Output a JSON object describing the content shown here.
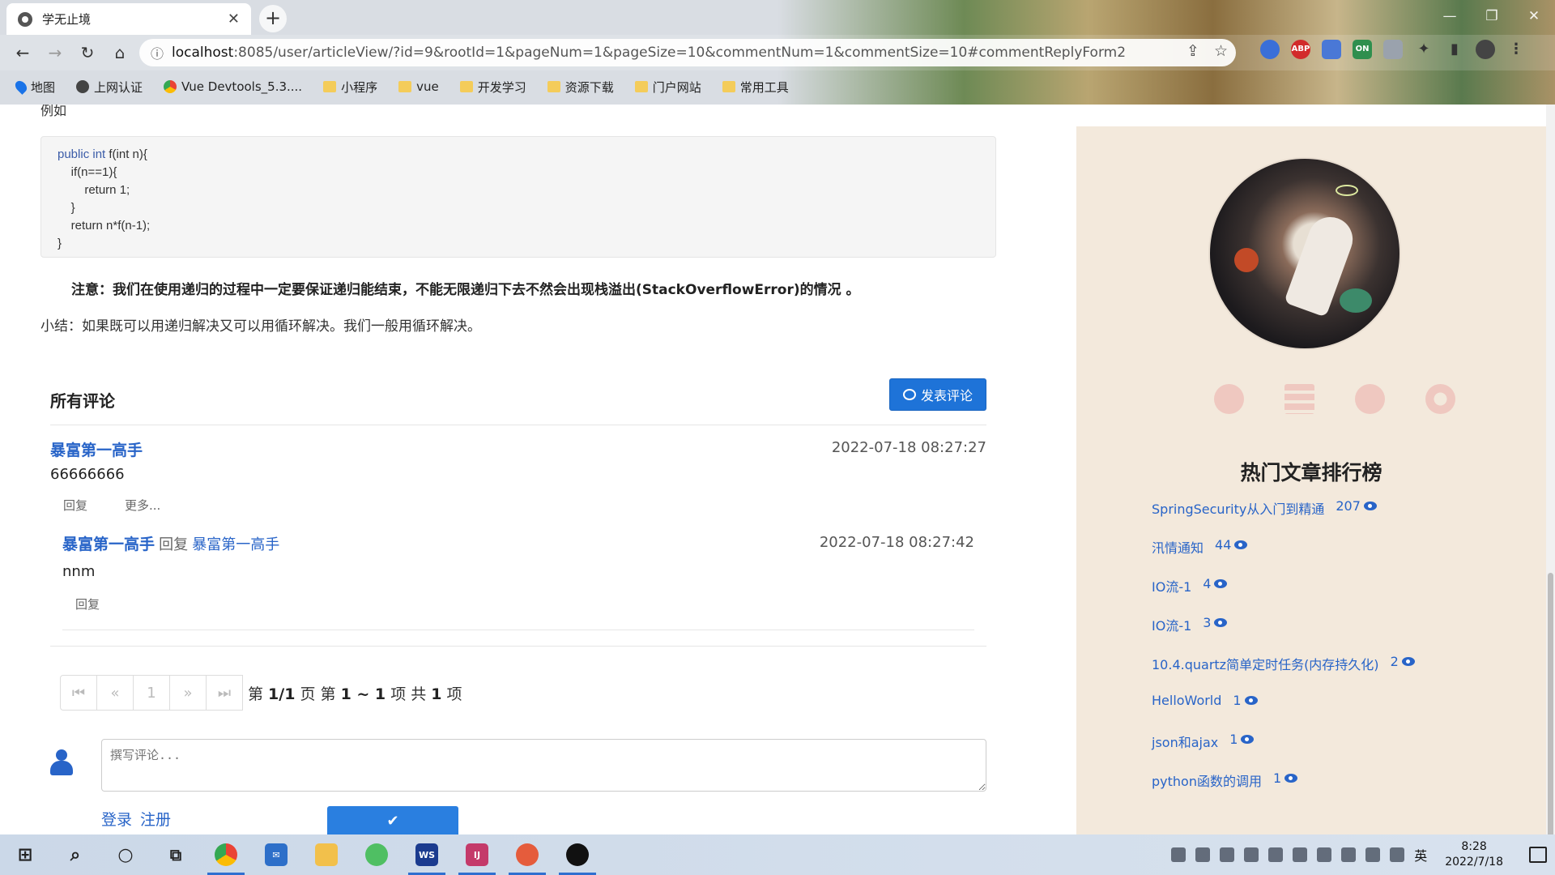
{
  "browser": {
    "tab_title": "学无止境",
    "tab_close": "✕",
    "new_tab": "+",
    "url_host": "localhost",
    "url_rest": ":8085/user/articleView/?id=9&rootId=1&pageNum=1&pageSize=10&commentNum=1&commentSize=10#commentReplyForm2",
    "extensions": [
      "ABP",
      "ON"
    ],
    "bookmarks": [
      "地图",
      "上网认证",
      "Vue Devtools_5.3....",
      "小程序",
      "vue",
      "开发学习",
      "资源下载",
      "门户网站",
      "常用工具"
    ]
  },
  "article": {
    "intro": "例如",
    "code": {
      "line1_kw1": "public int",
      "line1_rest": " f(int n){",
      "line2": "    if(n==1){",
      "line3": "        return 1;",
      "line4": "    }",
      "line5": "    return n*f(n-1);",
      "line6": "}"
    },
    "note": "注意：我们在使用递归的过程中一定要保证递归能结束，不能无限递归下去不然会出现栈溢出(StackOverflowError)的情况 。",
    "summary": "小结：如果既可以用递归解决又可以用循环解决。我们一般用循环解决。"
  },
  "comments": {
    "heading": "所有评论",
    "post_button": "发表评论",
    "items": [
      {
        "user": "暴富第一高手",
        "time": "2022-07-18 08:27:27",
        "body": "66666666",
        "reply_action": "回复",
        "more_action": "更多..."
      }
    ],
    "replies": [
      {
        "user": "暴富第一高手",
        "reply_word": "回复",
        "target": "暴富第一高手",
        "time": "2022-07-18 08:27:42",
        "body": "nnm",
        "reply_action": "回复"
      }
    ],
    "pager": {
      "buttons": [
        "⏮",
        "«",
        "1",
        "»",
        "⏭"
      ],
      "info_prefix": "第 ",
      "page": "1/1",
      "info_mid1": " 页  第 ",
      "range": "1 ~ 1",
      "info_mid2": " 项  共 ",
      "total": "1",
      "info_suffix": " 项"
    },
    "input_placeholder": "撰写评论...",
    "login": "登录",
    "register": "注册",
    "submit_symbol": "✔"
  },
  "sidebar": {
    "hot_title": "热门文章排行榜",
    "hot": [
      {
        "title": "SpringSecurity从入门到精通",
        "count": "207"
      },
      {
        "title": "汛情通知",
        "count": "44"
      },
      {
        "title": "IO流-1",
        "count": "4"
      },
      {
        "title": "IO流-1",
        "count": "3"
      },
      {
        "title": "10.4.quartz简单定时任务(内存持久化)",
        "count": "2"
      },
      {
        "title": "HelloWorld",
        "count": "1"
      },
      {
        "title": "json和ajax",
        "count": "1"
      },
      {
        "title": "python函数的调用",
        "count": "1"
      }
    ]
  },
  "taskbar": {
    "ime": "英",
    "time": "8:28",
    "date": "2022/7/18"
  }
}
